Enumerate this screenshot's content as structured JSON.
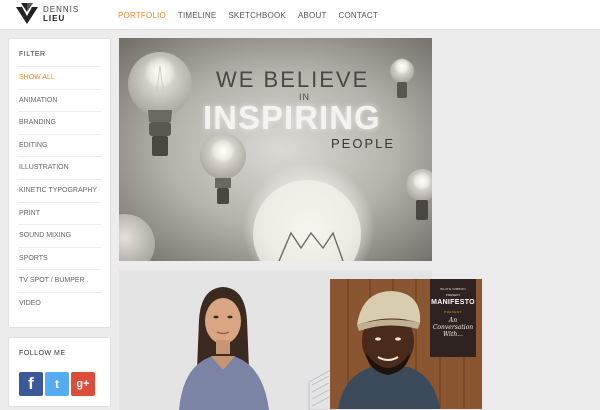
{
  "brand": {
    "name_line1": "DENNIS",
    "name_line2": "LIEU",
    "icon": "dl-logo-mark"
  },
  "nav": {
    "items": [
      {
        "label": "PORTFOLIO",
        "active": true
      },
      {
        "label": "TIMELINE",
        "active": false
      },
      {
        "label": "SKETCHBOOK",
        "active": false
      },
      {
        "label": "ABOUT",
        "active": false
      },
      {
        "label": "CONTACT",
        "active": false
      }
    ]
  },
  "filter": {
    "title": "FILTER",
    "items": [
      {
        "label": "SHOW ALL",
        "active": true
      },
      {
        "label": "ANIMATION",
        "active": false
      },
      {
        "label": "BRANDING",
        "active": false
      },
      {
        "label": "EDITING",
        "active": false
      },
      {
        "label": "ILLUSTRATION",
        "active": false
      },
      {
        "label": "KINETIC TYPOGRAPHY",
        "active": false
      },
      {
        "label": "PRINT",
        "active": false
      },
      {
        "label": "SOUND MIXING",
        "active": false
      },
      {
        "label": "SPORTS",
        "active": false
      },
      {
        "label": "TV SPOT / BUMPER",
        "active": false
      },
      {
        "label": "VIDEO",
        "active": false
      }
    ]
  },
  "follow": {
    "title": "FOLLOW ME",
    "icons": [
      {
        "name": "facebook-icon",
        "glyph": "f"
      },
      {
        "name": "twitter-icon",
        "glyph": "t"
      },
      {
        "name": "google-plus-icon",
        "glyph": "g+"
      }
    ]
  },
  "tiles": {
    "hero": {
      "line1": "WE BELIEVE",
      "line2": "IN",
      "line3": "INSPIRING",
      "line4": "PEOPLE"
    },
    "poster": {
      "brand": "WHITE RIBBON",
      "present": "PRESENT",
      "title": "MANIFESTO",
      "kicker": "PRESENT",
      "subtitle": "An Conversation With..."
    }
  },
  "colors": {
    "accent": "#e8892c",
    "background": "#ececec",
    "panel": "#ffffff",
    "facebook": "#3b5998",
    "twitter": "#55acee",
    "google_plus": "#dd4b39"
  }
}
